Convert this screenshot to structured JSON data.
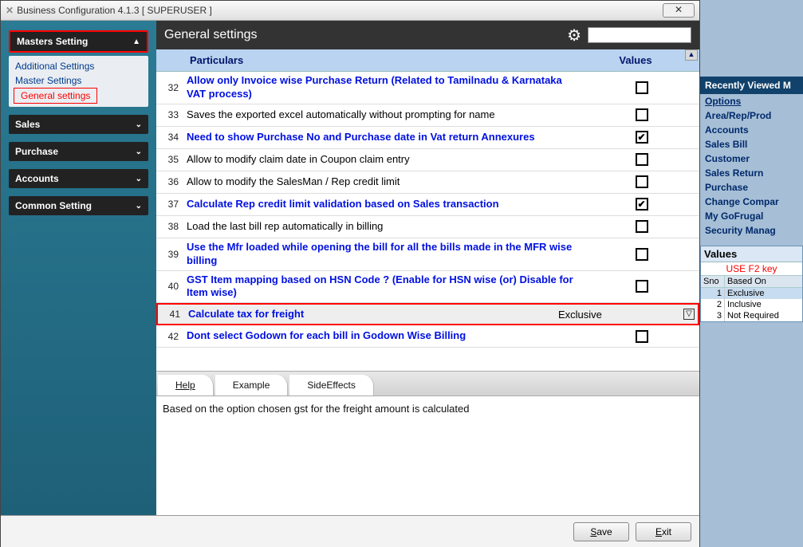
{
  "window": {
    "title": "Business Configuration 4.1.3 [ SUPERUSER ]"
  },
  "sidebar": {
    "masters": {
      "label": "Masters Setting"
    },
    "sub": {
      "additional": "Additional Settings",
      "master": "Master Settings",
      "general": "General settings"
    },
    "sales": "Sales",
    "purchase": "Purchase",
    "accounts": "Accounts",
    "common": "Common Setting"
  },
  "header": {
    "title": "General settings",
    "search_placeholder": ""
  },
  "columns": {
    "particulars": "Particulars",
    "values": "Values"
  },
  "rows": [
    {
      "num": "32",
      "text": "Allow only Invoice wise Purchase Return (Related to Tamilnadu & Karnataka VAT process)",
      "blue": true,
      "checked": false
    },
    {
      "num": "33",
      "text": "Saves the exported excel automatically without prompting for name",
      "blue": false,
      "checked": false
    },
    {
      "num": "34",
      "text": "Need to show Purchase No and Purchase date in Vat return Annexures",
      "blue": true,
      "checked": true
    },
    {
      "num": "35",
      "text": "Allow to modify claim date in Coupon claim entry",
      "blue": false,
      "checked": false
    },
    {
      "num": "36",
      "text": "Allow to modify the SalesMan / Rep credit limit",
      "blue": false,
      "checked": false
    },
    {
      "num": "37",
      "text": "Calculate Rep credit limit validation based on Sales transaction",
      "blue": true,
      "checked": true
    },
    {
      "num": "38",
      "text": "Load the last bill rep automatically in billing",
      "blue": false,
      "checked": false
    },
    {
      "num": "39",
      "text": "Use the Mfr loaded while opening the bill for all the bills made in the MFR wise billing",
      "blue": true,
      "checked": false
    },
    {
      "num": "40",
      "text": "GST Item mapping based on HSN Code ? (Enable for HSN wise (or) Disable for Item wise)",
      "blue": true,
      "checked": false
    },
    {
      "num": "41",
      "text": "Calculate tax for freight",
      "blue": true,
      "select_value": "Exclusive"
    },
    {
      "num": "42",
      "text": "Dont select Godown for each bill in Godown Wise Billing",
      "blue": true,
      "checked": false
    }
  ],
  "tabs": {
    "help": "Help",
    "example": "Example",
    "side": "SideEffects"
  },
  "help_text": "Based on the option chosen gst for the freight amount is calculated",
  "footer": {
    "save": "Save",
    "exit": "Exit"
  },
  "right": {
    "recent_head": "Recently Viewed M",
    "items": [
      "Options",
      "Area/Rep/Prod",
      "Accounts",
      "Sales Bill",
      "Customer",
      "Sales Return",
      "Purchase",
      "Change Compar",
      "My GoFrugal",
      "Security Manag"
    ]
  },
  "values_panel": {
    "title": "Values",
    "f2": "USE F2 key",
    "h1": "Sno",
    "h2": "Based On",
    "options": [
      {
        "n": "1",
        "v": "Exclusive"
      },
      {
        "n": "2",
        "v": "Inclusive"
      },
      {
        "n": "3",
        "v": "Not Required"
      }
    ]
  }
}
